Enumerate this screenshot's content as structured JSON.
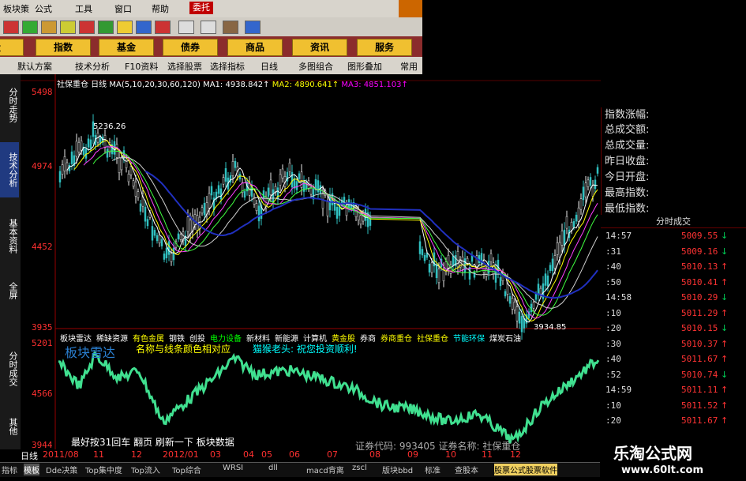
{
  "menu": {
    "items": [
      "板块策",
      "公式",
      "工具",
      "窗口",
      "帮助"
    ],
    "entrust": "委托"
  },
  "nav": {
    "buttons": [
      "股",
      "指数",
      "基金",
      "债券",
      "商品",
      "资讯",
      "服务"
    ]
  },
  "toolbar": {
    "items": [
      "默认方案",
      "技术分析",
      "F10资料",
      "选择股票",
      "选择指标",
      "日线",
      "多图组合",
      "图形叠加",
      "常用"
    ]
  },
  "vtabs": [
    "分时走势",
    "技术分析",
    "基本资料",
    "全屏",
    "分时成交",
    "其他"
  ],
  "chart": {
    "title": "社保重仓 日线",
    "ma_params": "MA(5,10,20,30,60,120)",
    "ma1": "MA1: 4938.842↑",
    "ma2": "MA2: 4890.641↑",
    "ma3": "MA3: 4851.103↑",
    "y_ticks": [
      "5498",
      "4974",
      "4452",
      "3935",
      "5201",
      "4566",
      "3944"
    ],
    "high_label": "5236.26",
    "low_label": "3934.85",
    "sub_title": "板块雷达",
    "sub_hint": "名称与线条颜色相对应",
    "sub_wish": "猫猴老头: 祝您投资顺利!",
    "bottom_hint": "最好按31回车  翻页  刷新一下  板块数据",
    "bottom_code": "证券代码: 993405  证券名称: 社保重仓",
    "colors": {
      "axis": "#ff3030",
      "price": "#ff3333",
      "green": "#00cc55"
    }
  },
  "sectors": [
    {
      "name": "板块雷达",
      "color": "#ffffff"
    },
    {
      "name": "稀缺资源",
      "color": "#ffffff"
    },
    {
      "name": "有色金属",
      "color": "#ffff00"
    },
    {
      "name": "钢铁",
      "color": "#ffffff"
    },
    {
      "name": "创投",
      "color": "#ffffff"
    },
    {
      "name": "电力设备",
      "color": "#00ff00"
    },
    {
      "name": "新材料",
      "color": "#ffffff"
    },
    {
      "name": "新能源",
      "color": "#ffffff"
    },
    {
      "name": "计算机",
      "color": "#ffffff"
    },
    {
      "name": "黄金股",
      "color": "#ffff00"
    },
    {
      "name": "券商",
      "color": "#ffffff"
    },
    {
      "name": "券商重仓",
      "color": "#ffff00"
    },
    {
      "name": "社保重仓",
      "color": "#ffff00"
    },
    {
      "name": "节能环保",
      "color": "#00ffff"
    },
    {
      "name": "煤炭石油",
      "color": "#ffffff"
    }
  ],
  "index_panel": {
    "rows": [
      "指数涨幅:",
      "总成交额:",
      "总成交量:",
      "昨日收盘:",
      "今日开盘:",
      "最高指数:",
      "最低指数:"
    ]
  },
  "trades": {
    "title": "分时成交",
    "rows": [
      {
        "time": "14:57",
        "price": "5009.55",
        "dir": "down"
      },
      {
        "time": ":31",
        "price": "5009.16",
        "dir": "down"
      },
      {
        "time": ":40",
        "price": "5010.13",
        "dir": "up"
      },
      {
        "time": ":50",
        "price": "5010.41",
        "dir": "up"
      },
      {
        "time": "14:58",
        "price": "5010.29",
        "dir": "down"
      },
      {
        "time": ":10",
        "price": "5011.29",
        "dir": "up"
      },
      {
        "time": ":20",
        "price": "5010.15",
        "dir": "down"
      },
      {
        "time": ":30",
        "price": "5010.37",
        "dir": "up"
      },
      {
        "time": ":40",
        "price": "5011.67",
        "dir": "up"
      },
      {
        "time": ":52",
        "price": "5010.74",
        "dir": "down"
      },
      {
        "time": "14:59",
        "price": "5011.11",
        "dir": "up"
      },
      {
        "time": ":10",
        "price": "5011.52",
        "dir": "up"
      },
      {
        "time": ":20",
        "price": "5011.67",
        "dir": "up"
      }
    ]
  },
  "dates": [
    "日线",
    "2011/08",
    "11",
    "12",
    "2012/01",
    "03",
    "04",
    "05",
    "06",
    "07",
    "08",
    "09",
    "10",
    "11",
    "12"
  ],
  "bottom_tabs": [
    "指标",
    "模板",
    "Dde决策",
    "Top集中度",
    "Top流入",
    "Top综合",
    "WRSI",
    "dll",
    "macd背离",
    "zscl",
    "版块bbd",
    "标准",
    "查股本",
    "股票公式股票软件"
  ],
  "watermark": {
    "title": "乐淘公式网",
    "url": "www.60lt.com"
  }
}
